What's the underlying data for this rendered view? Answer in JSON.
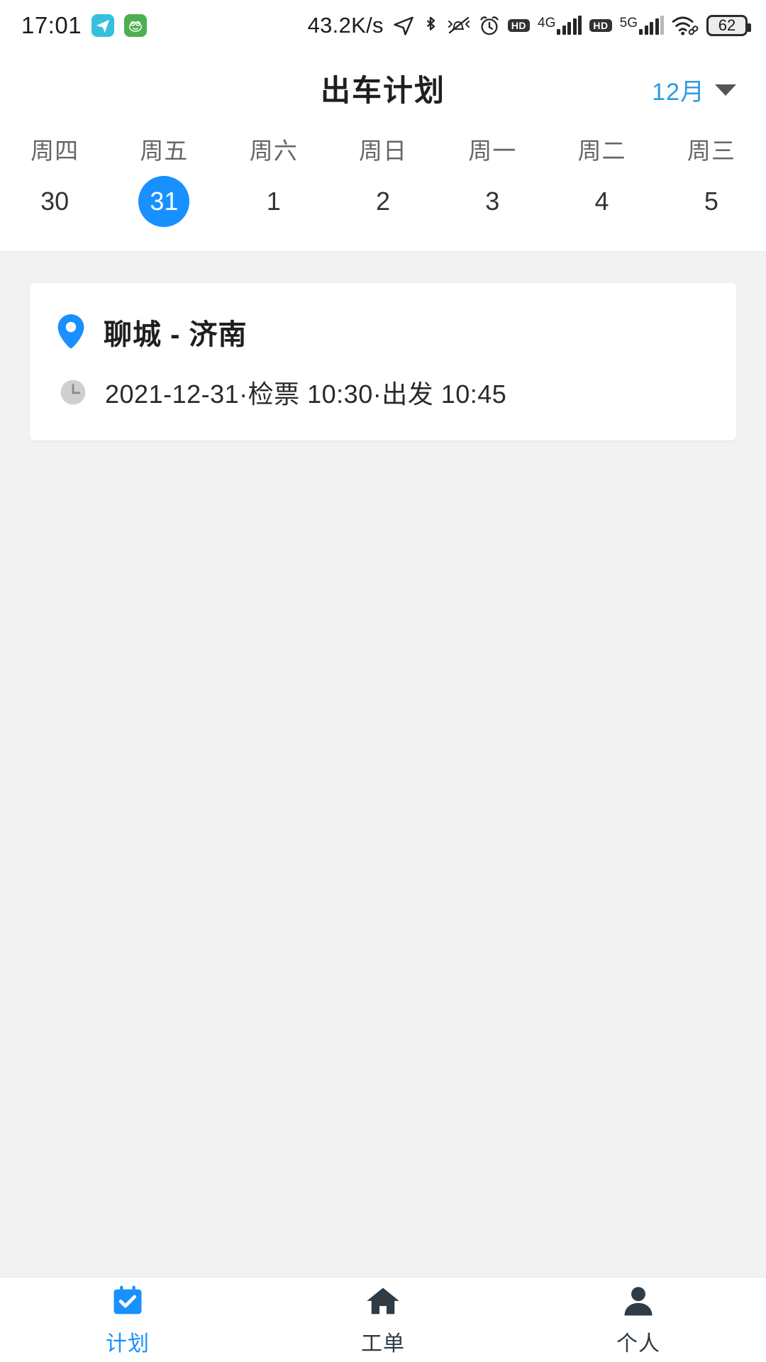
{
  "status_bar": {
    "time": "17:01",
    "network_speed": "43.2K/s",
    "battery_level": "62",
    "icons": [
      {
        "name": "telegram-app-icon",
        "color": "#36c0dd"
      },
      {
        "name": "frog-app-icon",
        "color": "#4caf50"
      },
      {
        "name": "location-arrow-icon"
      },
      {
        "name": "bluetooth-icon"
      },
      {
        "name": "mute-vibrate-icon"
      },
      {
        "name": "alarm-clock-icon"
      },
      {
        "name": "hd-badge-icon"
      },
      {
        "name": "signal-4g-icon"
      },
      {
        "name": "hd-badge-icon"
      },
      {
        "name": "signal-5g-icon"
      },
      {
        "name": "wifi-link-icon"
      },
      {
        "name": "battery-icon"
      }
    ],
    "net_4g_label": "4G",
    "net_5g_label": "5G",
    "hd_label": "HD"
  },
  "header": {
    "title": "出车计划",
    "month_label": "12月",
    "month_accent_color": "#2b9ae8"
  },
  "week_strip": {
    "selected_index": 1,
    "selected_color": "#1890ff",
    "days": [
      {
        "dow": "周四",
        "num": "30"
      },
      {
        "dow": "周五",
        "num": "31"
      },
      {
        "dow": "周六",
        "num": "1"
      },
      {
        "dow": "周日",
        "num": "2"
      },
      {
        "dow": "周一",
        "num": "3"
      },
      {
        "dow": "周二",
        "num": "4"
      },
      {
        "dow": "周三",
        "num": "5"
      }
    ]
  },
  "plan_cards": [
    {
      "route": "聊城 - 济南",
      "detail": "2021-12-31·检票 10:30·出发 10:45",
      "pin_color": "#1890ff"
    }
  ],
  "tab_bar": {
    "active_index": 0,
    "active_color": "#1890ff",
    "inactive_color": "#2f3b45",
    "tabs": [
      {
        "label": "计划",
        "icon": "calendar-check-icon"
      },
      {
        "label": "工单",
        "icon": "home-icon"
      },
      {
        "label": "个人",
        "icon": "person-icon"
      }
    ]
  }
}
